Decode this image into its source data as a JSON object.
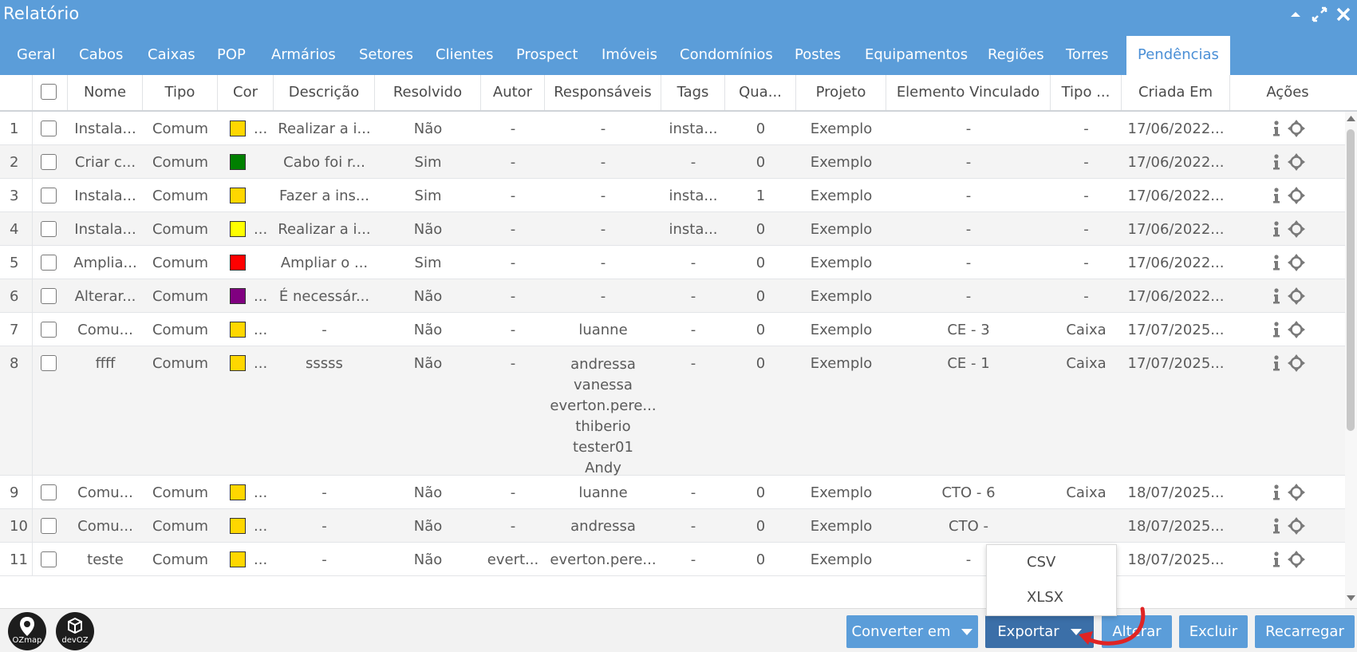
{
  "window": {
    "title": "Relatório",
    "controls": [
      "collapse-icon",
      "maximize-icon",
      "close-icon"
    ]
  },
  "tabs": [
    {
      "label": "Geral"
    },
    {
      "label": "Cabos"
    },
    {
      "label": "Caixas"
    },
    {
      "label": "POP"
    },
    {
      "label": "Armários"
    },
    {
      "label": "Setores"
    },
    {
      "label": "Clientes"
    },
    {
      "label": "Prospect"
    },
    {
      "label": "Imóveis"
    },
    {
      "label": "Condomínios"
    },
    {
      "label": "Postes"
    },
    {
      "label": "Equipamentos"
    },
    {
      "label": "Regiões"
    },
    {
      "label": "Torres"
    },
    {
      "label": "Pendências",
      "active": true
    }
  ],
  "table": {
    "columns": [
      "Nome",
      "Tipo",
      "Cor",
      "Descrição",
      "Resolvido",
      "Autor",
      "Responsáveis",
      "Tags",
      "Qua...",
      "Projeto",
      "Elemento Vinculado",
      "Tipo ...",
      "Criada Em",
      "Ações"
    ],
    "rows": [
      {
        "num": "1",
        "nome": "Instala...",
        "tipo": "Comum",
        "cor": "#ffd700",
        "cor_dots": "...",
        "descricao": "Realizar a i...",
        "resolvido": "Não",
        "autor": "-",
        "responsaveis": [
          "-"
        ],
        "tags": "insta...",
        "qua": "0",
        "projeto": "Exemplo",
        "elemento": "-",
        "tipo_el": "-",
        "criada": "17/06/2022..."
      },
      {
        "num": "2",
        "nome": "Criar c...",
        "tipo": "Comum",
        "cor": "#008000",
        "cor_dots": "",
        "descricao": "Cabo foi r...",
        "resolvido": "Sim",
        "autor": "-",
        "responsaveis": [
          "-"
        ],
        "tags": "-",
        "qua": "0",
        "projeto": "Exemplo",
        "elemento": "-",
        "tipo_el": "-",
        "criada": "17/06/2022..."
      },
      {
        "num": "3",
        "nome": "Instala...",
        "tipo": "Comum",
        "cor": "#ffd700",
        "cor_dots": "",
        "descricao": "Fazer a ins...",
        "resolvido": "Sim",
        "autor": "-",
        "responsaveis": [
          "-"
        ],
        "tags": "insta...",
        "qua": "1",
        "projeto": "Exemplo",
        "elemento": "-",
        "tipo_el": "-",
        "criada": "17/06/2022..."
      },
      {
        "num": "4",
        "nome": "Instala...",
        "tipo": "Comum",
        "cor": "#ffff00",
        "cor_dots": "...",
        "descricao": "Realizar a i...",
        "resolvido": "Não",
        "autor": "-",
        "responsaveis": [
          "-"
        ],
        "tags": "insta...",
        "qua": "0",
        "projeto": "Exemplo",
        "elemento": "-",
        "tipo_el": "-",
        "criada": "17/06/2022..."
      },
      {
        "num": "5",
        "nome": "Amplia...",
        "tipo": "Comum",
        "cor": "#ff0000",
        "cor_dots": "",
        "descricao": "Ampliar o ...",
        "resolvido": "Sim",
        "autor": "-",
        "responsaveis": [
          "-"
        ],
        "tags": "-",
        "qua": "0",
        "projeto": "Exemplo",
        "elemento": "-",
        "tipo_el": "-",
        "criada": "17/06/2022..."
      },
      {
        "num": "6",
        "nome": "Alterar...",
        "tipo": "Comum",
        "cor": "#800080",
        "cor_dots": "...",
        "descricao": "É necessár...",
        "resolvido": "Não",
        "autor": "-",
        "responsaveis": [
          "-"
        ],
        "tags": "-",
        "qua": "0",
        "projeto": "Exemplo",
        "elemento": "-",
        "tipo_el": "-",
        "criada": "17/06/2022..."
      },
      {
        "num": "7",
        "nome": "Comu...",
        "tipo": "Comum",
        "cor": "#ffd700",
        "cor_dots": "...",
        "descricao": "-",
        "resolvido": "Não",
        "autor": "-",
        "responsaveis": [
          "luanne"
        ],
        "tags": "-",
        "qua": "0",
        "projeto": "Exemplo",
        "elemento": "CE - 3",
        "tipo_el": "Caixa",
        "criada": "17/07/2025..."
      },
      {
        "num": "8",
        "nome": "ffff",
        "tipo": "Comum",
        "cor": "#ffd700",
        "cor_dots": "...",
        "descricao": "sssss",
        "resolvido": "Não",
        "autor": "-",
        "responsaveis": [
          "andressa",
          "vanessa",
          "everton.pere...",
          "thiberio",
          "tester01",
          "Andy"
        ],
        "tags": "-",
        "qua": "0",
        "projeto": "Exemplo",
        "elemento": "CE - 1",
        "tipo_el": "Caixa",
        "criada": "17/07/2025..."
      },
      {
        "num": "9",
        "nome": "Comu...",
        "tipo": "Comum",
        "cor": "#ffd700",
        "cor_dots": "...",
        "descricao": "-",
        "resolvido": "Não",
        "autor": "-",
        "responsaveis": [
          "luanne"
        ],
        "tags": "-",
        "qua": "0",
        "projeto": "Exemplo",
        "elemento": "CTO - 6",
        "tipo_el": "Caixa",
        "criada": "18/07/2025..."
      },
      {
        "num": "10",
        "nome": "Comu...",
        "tipo": "Comum",
        "cor": "#ffd700",
        "cor_dots": "...",
        "descricao": "-",
        "resolvido": "Não",
        "autor": "-",
        "responsaveis": [
          "andressa"
        ],
        "tags": "-",
        "qua": "0",
        "projeto": "Exemplo",
        "elemento": "CTO -",
        "tipo_el": "",
        "criada": "18/07/2025..."
      },
      {
        "num": "11",
        "nome": "teste",
        "tipo": "Comum",
        "cor": "#ffd700",
        "cor_dots": "...",
        "descricao": "-",
        "resolvido": "Não",
        "autor": "evert...",
        "responsaveis": [
          "everton.pere..."
        ],
        "tags": "-",
        "qua": "0",
        "projeto": "Exemplo",
        "elemento": "-",
        "tipo_el": "",
        "criada": "18/07/2025..."
      }
    ],
    "row_actions": [
      "info-icon",
      "locate-icon"
    ]
  },
  "footer": {
    "logos": [
      "OZmap",
      "devOZ"
    ],
    "buttons": {
      "converter": "Converter em",
      "exportar": "Exportar",
      "alterar": "Alterar",
      "excluir": "Excluir",
      "recarregar": "Recarregar"
    }
  },
  "export_menu": {
    "items": [
      "CSV",
      "XLSX"
    ]
  },
  "colors": {
    "primary": "#5b9dd9",
    "active_button": "#3b6fa8",
    "annotation_arrow": "#e02424"
  }
}
